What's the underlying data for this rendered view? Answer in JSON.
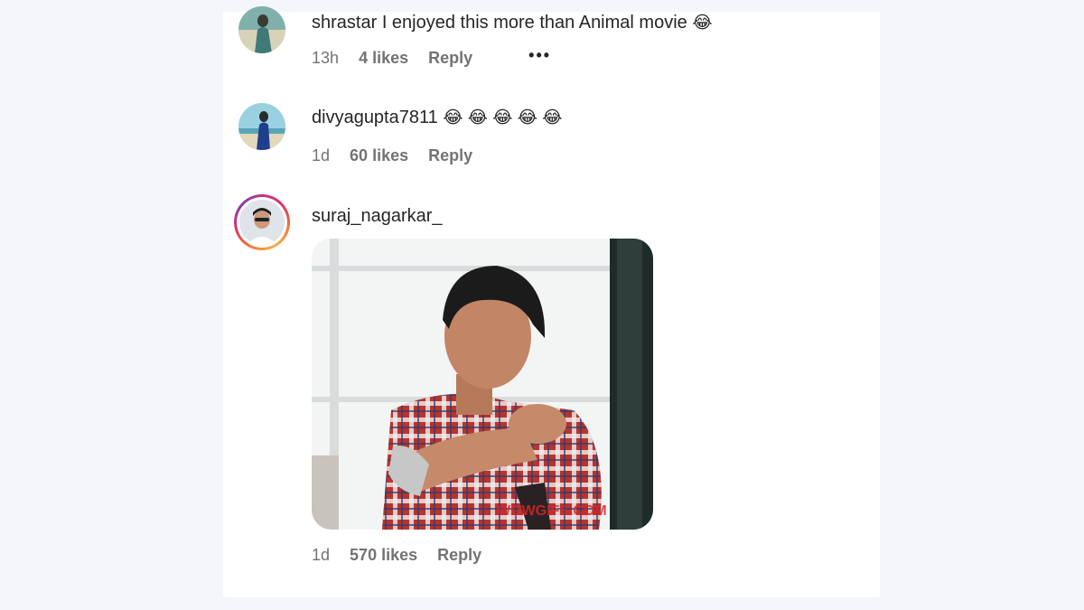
{
  "comments": [
    {
      "username": "shrastar",
      "text": "I enjoyed this more than Animal movie",
      "emoji": "😂",
      "time": "13h",
      "likes": "4 likes",
      "reply": "Reply",
      "more": "•••"
    },
    {
      "username": "divyagupta7811",
      "text": "",
      "emoji": "😂 😂 😂 😂 😂",
      "time": "1d",
      "likes": "60 likes",
      "reply": "Reply"
    },
    {
      "username": "suraj_nagarkar_",
      "text": "",
      "time": "1d",
      "likes": "570 likes",
      "reply": "Reply",
      "gif_watermark": "WOWGIFS.COM"
    }
  ],
  "colors": {
    "background": "#f4f6fb",
    "panel": "#ffffff",
    "text": "#262626",
    "meta": "#737373",
    "story_ring": [
      "#c13584",
      "#e1306c",
      "#f77737",
      "#fcaf45"
    ]
  },
  "icons": {
    "more_options": "ellipsis-icon"
  }
}
